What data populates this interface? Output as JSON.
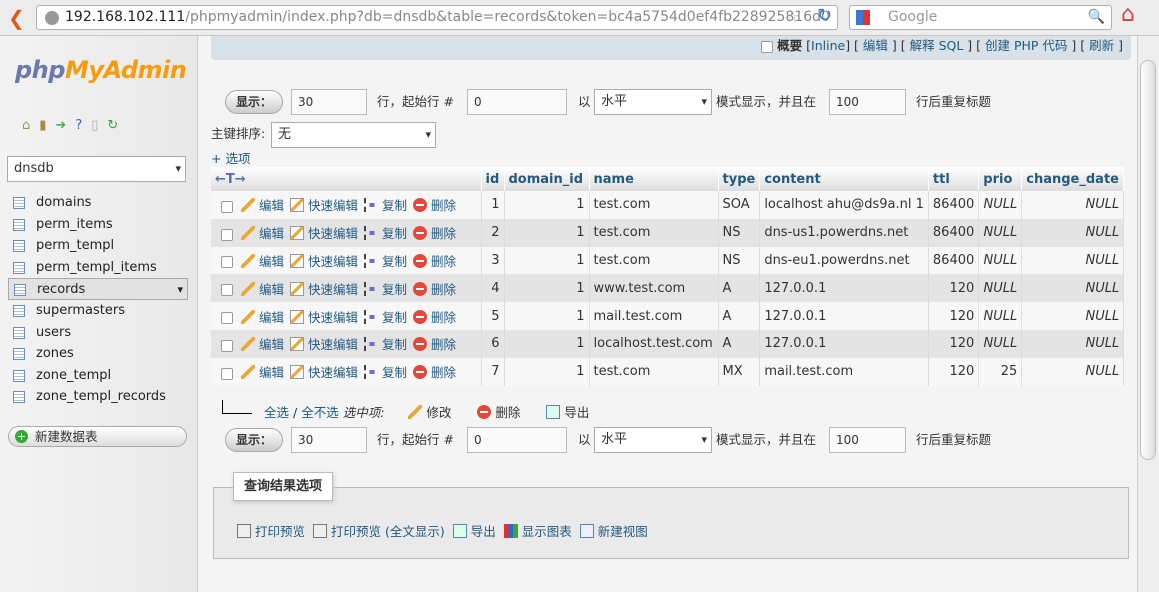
{
  "browser": {
    "url_host": "192.168.102.111",
    "url_path": "/phpmyadmin/index.php?db=dnsdb&table=records&token=bc4a5754d0ef4fb228925816d0",
    "search_placeholder": "Google"
  },
  "sidebar": {
    "logo_php": "php",
    "logo_myadmin": "MyAdmin",
    "database": "dnsdb",
    "tables": [
      "domains",
      "perm_items",
      "perm_templ",
      "perm_templ_items",
      "records",
      "supermasters",
      "users",
      "zones",
      "zone_templ",
      "zone_templ_records"
    ],
    "selected_table": "records",
    "new_table": "新建数据表"
  },
  "topbar": {
    "profiling": "概要",
    "inline": "Inline",
    "edit": "编辑",
    "explain": "解释 SQL",
    "php_code": "创建 PHP 代码",
    "refresh": "刷新"
  },
  "nav": {
    "show": "显示：",
    "rows": "30",
    "rows_label": "行，起始行 #",
    "start": "0",
    "mode_prefix": "以",
    "mode": "水平",
    "mode_label": "模式显示，并且在",
    "repeat": "100",
    "repeat_label": "行后重复标题",
    "sort_label": "主键排序:",
    "sort_value": "无",
    "options": "+ 选项"
  },
  "table": {
    "columns": [
      "id",
      "domain_id",
      "name",
      "type",
      "content",
      "ttl",
      "prio",
      "change_date"
    ],
    "actions": {
      "edit": "编辑",
      "quick_edit": "快速编辑",
      "copy": "复制",
      "delete": "删除"
    },
    "rows": [
      [
        "1",
        "1",
        "test.com",
        "SOA",
        "localhost ahu@ds9a.nl 1",
        "86400",
        "NULL",
        "NULL"
      ],
      [
        "2",
        "1",
        "test.com",
        "NS",
        "dns-us1.powerdns.net",
        "86400",
        "NULL",
        "NULL"
      ],
      [
        "3",
        "1",
        "test.com",
        "NS",
        "dns-eu1.powerdns.net",
        "86400",
        "NULL",
        "NULL"
      ],
      [
        "4",
        "1",
        "www.test.com",
        "A",
        "127.0.0.1",
        "120",
        "NULL",
        "NULL"
      ],
      [
        "5",
        "1",
        "mail.test.com",
        "A",
        "127.0.0.1",
        "120",
        "NULL",
        "NULL"
      ],
      [
        "6",
        "1",
        "localhost.test.com",
        "A",
        "127.0.0.1",
        "120",
        "NULL",
        "NULL"
      ],
      [
        "7",
        "1",
        "test.com",
        "MX",
        "mail.test.com",
        "120",
        "25",
        "NULL"
      ]
    ]
  },
  "bulk": {
    "check_all": "全选",
    "uncheck_all": "全不选",
    "with_selected": "选中项:",
    "change": "修改",
    "delete": "删除",
    "export": "导出"
  },
  "query_ops": {
    "legend": "查询结果选项",
    "print": "打印预览",
    "print_full": "打印预览 (全文显示)",
    "export": "导出",
    "chart": "显示图表",
    "view": "新建视图"
  }
}
